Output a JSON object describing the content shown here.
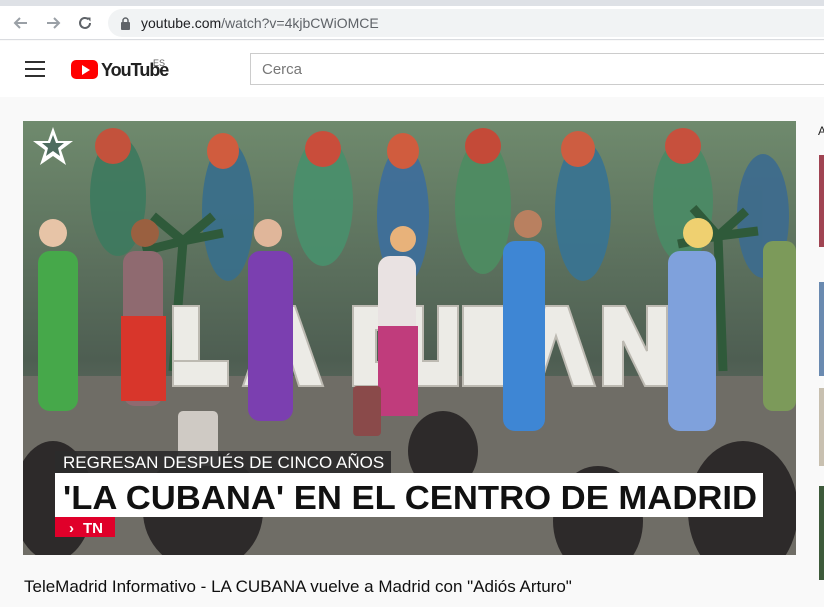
{
  "browser": {
    "url_host": "youtube.com",
    "url_path": "/watch?v=4kjbCWiOMCE"
  },
  "header": {
    "logo_text": "YouTube",
    "logo_country": "ES",
    "search_placeholder": "Cerca"
  },
  "video": {
    "overlay_kicker": "REGRESAN DESPUÉS DE CINCO AÑOS",
    "overlay_headline": "'LA CUBANA' EN EL CENTRO DE MADRID",
    "overlay_channel_badge": "TN",
    "stage_letters": "LA CUBANA"
  },
  "main": {
    "video_title": "TeleMadrid Informativo - LA CUBANA vuelve a Madrid con \"Adiós Arturo\""
  },
  "sidebar": {
    "letter": "A"
  },
  "colors": {
    "youtube_red": "#ff0000",
    "overlay_badge_red": "#e0002a"
  },
  "icons": [
    "back-arrow-icon",
    "forward-arrow-icon",
    "reload-icon",
    "lock-icon",
    "menu-icon",
    "youtube-play-icon",
    "telemadrid-star-icon"
  ]
}
